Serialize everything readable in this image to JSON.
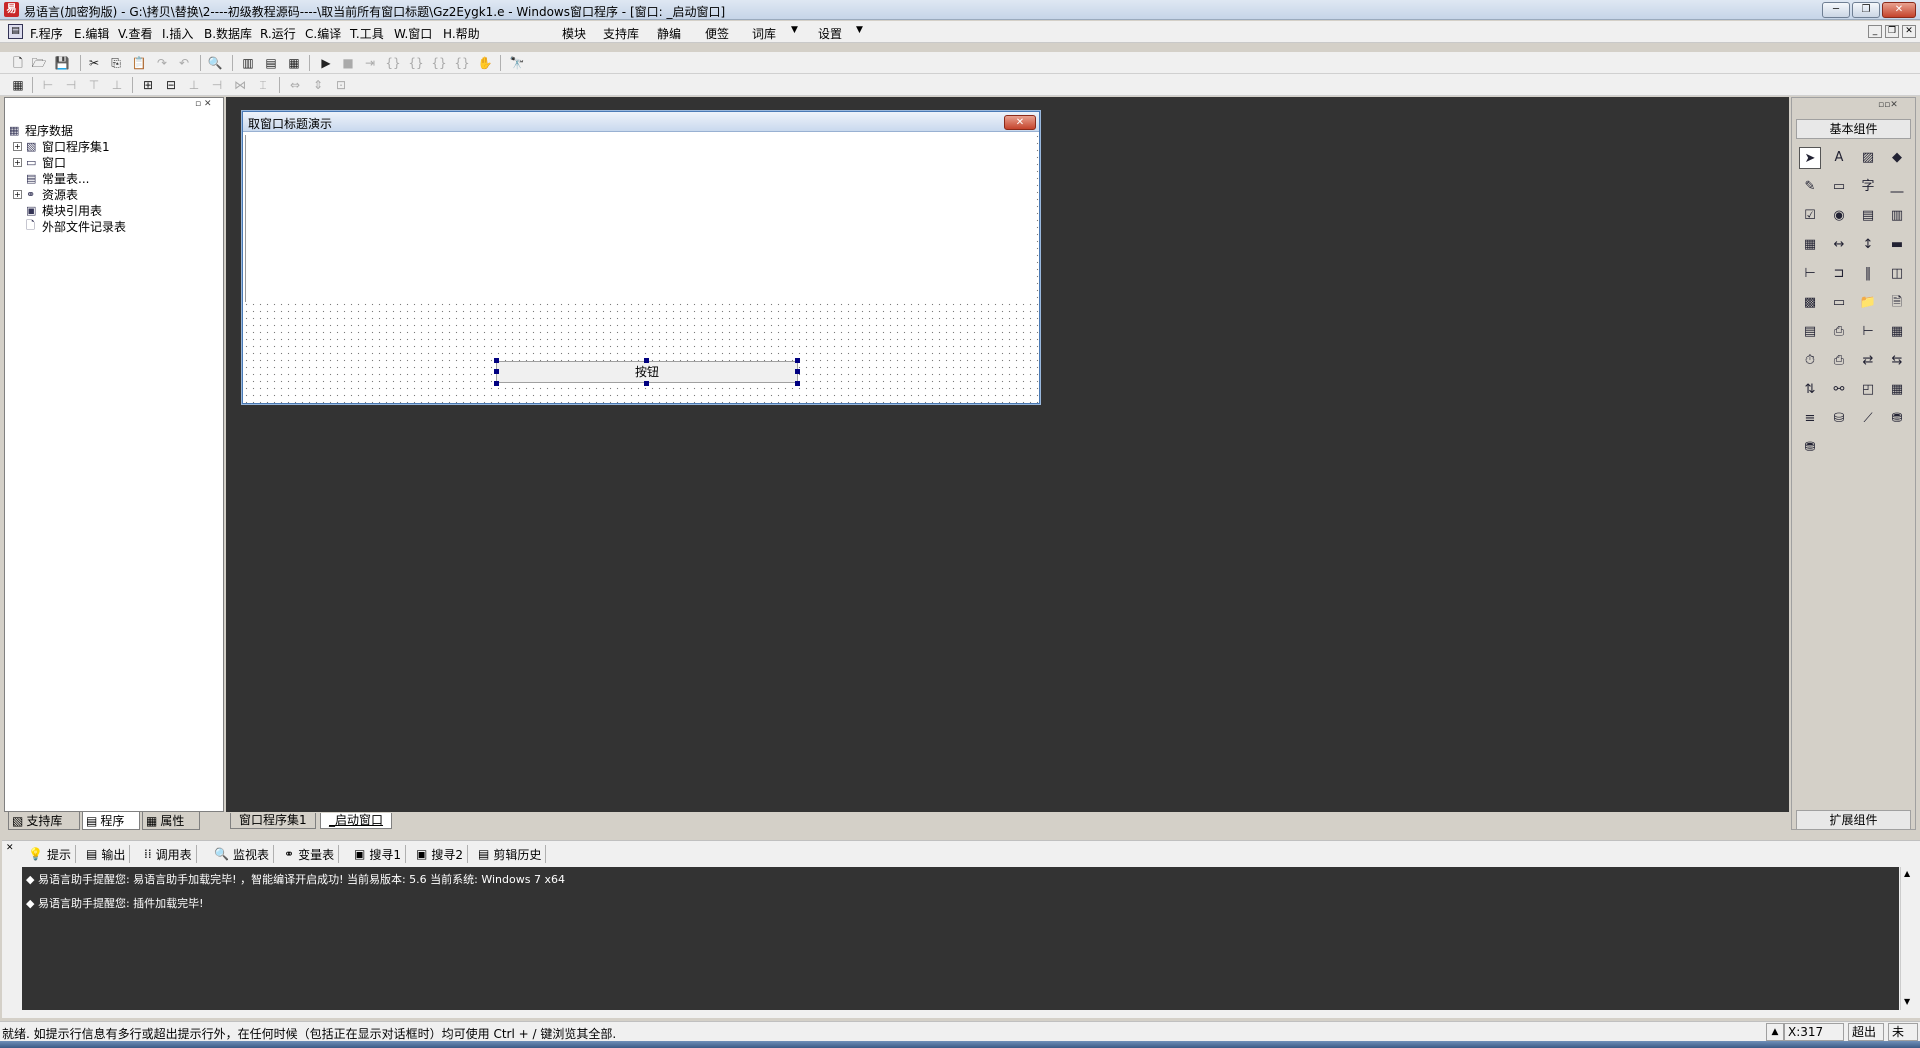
{
  "window": {
    "title": "易语言(加密狗版) - G:\\拷贝\\替换\\2----初级教程源码----\\取当前所有窗口标题\\Gz2Eygk1.e - Windows窗口程序 - [窗口: _启动窗口]",
    "controls": [
      "─",
      "❐",
      "✕"
    ]
  },
  "menu": {
    "items": [
      "F.程序",
      "E.编辑",
      "V.查看",
      "I.插入",
      "B.数据库",
      "R.运行",
      "C.编译",
      "T.工具",
      "W.窗口",
      "H.帮助"
    ],
    "extra": [
      "模块",
      "支持库",
      "静编",
      "便签",
      "词库",
      "设置"
    ],
    "mdi_controls": [
      "_",
      "❐",
      "✕"
    ]
  },
  "left_panel": {
    "root": "程序数据",
    "items": [
      {
        "label": "窗口程序集1",
        "expandable": true
      },
      {
        "label": "窗口",
        "expandable": true
      },
      {
        "label": "常量表...",
        "expandable": false
      },
      {
        "label": "资源表",
        "expandable": true
      },
      {
        "label": "模块引用表",
        "expandable": false
      },
      {
        "label": "外部文件记录表",
        "expandable": false
      }
    ],
    "tabs": [
      "支持库",
      "程序",
      "属性"
    ]
  },
  "design_window": {
    "title": "取窗口标题演示",
    "button_label": "按钮"
  },
  "doc_tabs": [
    "窗口程序集1",
    "_启动窗口"
  ],
  "right_panel": {
    "header": "基本组件",
    "footer": "扩展组件"
  },
  "bottom_tabs": [
    "提示",
    "输出",
    "调用表",
    "监视表",
    "变量表",
    "搜寻1",
    "搜寻2",
    "剪辑历史"
  ],
  "output_lines": [
    "◆ 易语言助手提醒您: 易语言助手加载完毕! ，智能编译开启成功! 当前易版本: 5.6 当前系统: Windows 7 x64",
    "◆ 易语言助手提醒您: 插件加载完毕!"
  ],
  "status": {
    "text": "就绪. 如提示行信息有多行或超出提示行外，在任何时候（包括正在显示对话框时）均可使用 Ctrl + / 键浏览其全部.",
    "coord": "X:317",
    "mode1": "超出",
    "mode2": "未改"
  }
}
